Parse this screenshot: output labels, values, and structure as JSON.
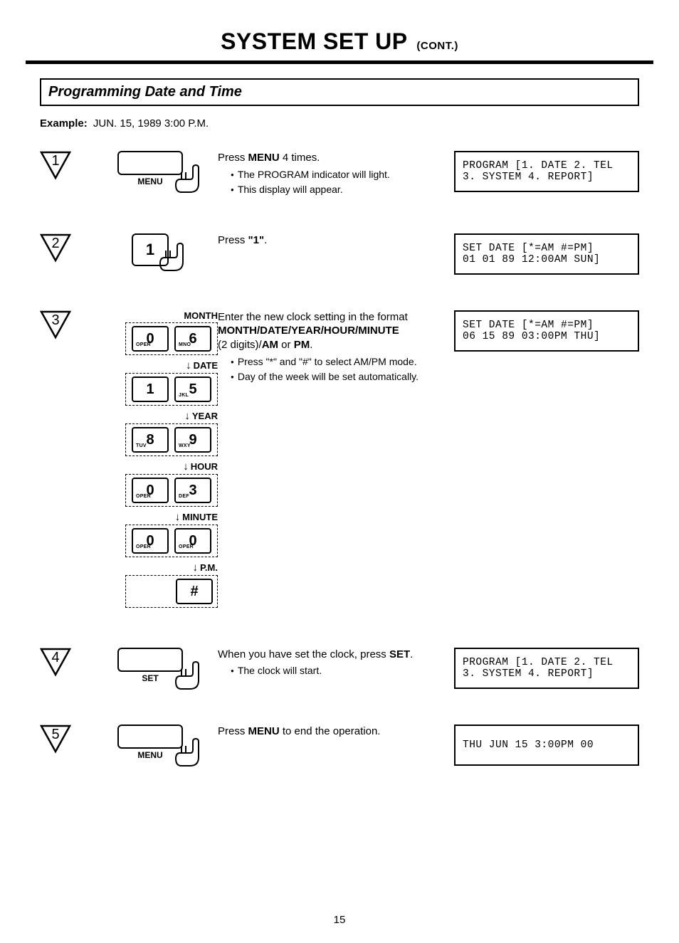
{
  "title_main": "SYSTEM SET UP",
  "title_cont": "(CONT.)",
  "section_title": "Programming Date and Time",
  "example_label": "Example:",
  "example_value": "JUN. 15, 1989 3:00 P.M.",
  "page_number": "15",
  "steps": [
    {
      "num": "1",
      "button_label": "MENU",
      "body_main": "Press ",
      "body_bold": "MENU",
      "body_after": " 4 times.",
      "bullets": [
        "The PROGRAM indicator will light.",
        "This display will appear."
      ],
      "lcd": [
        "PROGRAM [1. DATE 2. TEL",
        "3. SYSTEM 4. REPORT]"
      ]
    },
    {
      "num": "2",
      "key_digit": "1",
      "body_main": "Press ",
      "body_bold": "\"1\"",
      "body_after": ".",
      "lcd": [
        "SET DATE [*=AM #=PM]",
        "01 01 89 12:00AM SUN]"
      ]
    },
    {
      "num": "3",
      "body_line1": "Enter the new clock setting in the format",
      "body_line2_bold": "MONTH/DATE/YEAR/HOUR/MINUTE",
      "body_line3_a": "(2 digits)/",
      "body_line3_b": "AM",
      "body_line3_c": " or ",
      "body_line3_d": "PM",
      "body_line3_e": ".",
      "bullets": [
        "Press \"*\" and \"#\" to select AM/PM mode.",
        "Day of the week will be set automatically."
      ],
      "lcd": [
        "SET DATE [*=AM #=PM]",
        "06 15 89 03:00PM THU]"
      ],
      "groups": [
        {
          "title": "MONTH",
          "arrow": false,
          "keys": [
            {
              "sm": "OPER",
              "big": "0"
            },
            {
              "sm": "MNO",
              "big": "6"
            }
          ]
        },
        {
          "title": "DATE",
          "arrow": true,
          "keys": [
            {
              "sm": "",
              "big": "1"
            },
            {
              "sm": "JKL",
              "big": "5"
            }
          ]
        },
        {
          "title": "YEAR",
          "arrow": true,
          "keys": [
            {
              "sm": "TUV",
              "big": "8"
            },
            {
              "sm": "WXY",
              "big": "9"
            }
          ]
        },
        {
          "title": "HOUR",
          "arrow": true,
          "keys": [
            {
              "sm": "OPER",
              "big": "0"
            },
            {
              "sm": "DEF",
              "big": "3"
            }
          ]
        },
        {
          "title": "MINUTE",
          "arrow": true,
          "keys": [
            {
              "sm": "OPER",
              "big": "0"
            },
            {
              "sm": "OPER",
              "big": "0"
            }
          ]
        },
        {
          "title": "P.M.",
          "arrow": true,
          "keys": [
            {
              "sm": "",
              "big": "#"
            }
          ],
          "single": true
        }
      ]
    },
    {
      "num": "4",
      "button_label": "SET",
      "body_main": "When you have set the clock, press ",
      "body_bold": "SET",
      "body_after": ".",
      "bullets": [
        "The clock will start."
      ],
      "lcd": [
        "PROGRAM [1. DATE 2. TEL",
        "3. SYSTEM 4. REPORT]"
      ]
    },
    {
      "num": "5",
      "button_label": "MENU",
      "body_main": "Press ",
      "body_bold": "MENU",
      "body_after": " to end the operation.",
      "lcd": [
        "THU JUN 15 3:00PM 00"
      ]
    }
  ]
}
